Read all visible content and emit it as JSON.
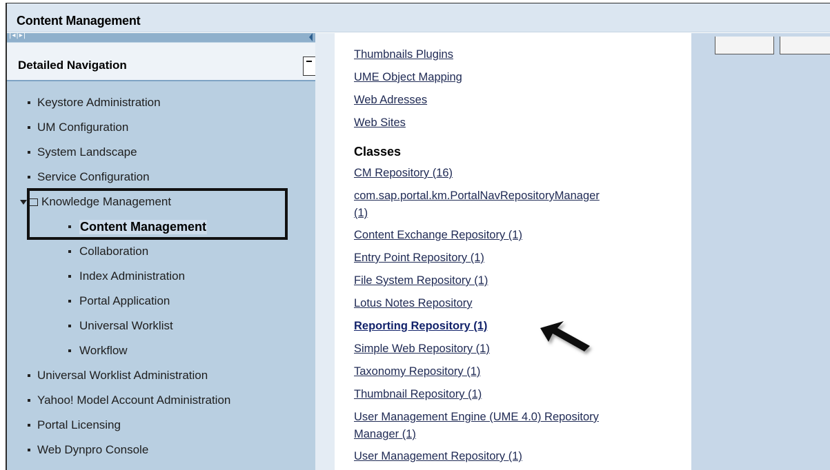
{
  "window": {
    "title": "Content Management"
  },
  "sidebar": {
    "header": "Detailed Navigation",
    "items": [
      {
        "label": "Keystore Administration",
        "level": 1
      },
      {
        "label": "UM Configuration",
        "level": 1
      },
      {
        "label": "System Landscape",
        "level": 1
      },
      {
        "label": "Service Configuration",
        "level": 1
      },
      {
        "label": "Knowledge Management",
        "level": 1,
        "folder": true,
        "expanded": true
      },
      {
        "label": "Content Management",
        "level": 2,
        "selected": true
      },
      {
        "label": "Collaboration",
        "level": 2
      },
      {
        "label": "Index Administration",
        "level": 2
      },
      {
        "label": "Portal Application",
        "level": 2
      },
      {
        "label": "Universal Worklist",
        "level": 2
      },
      {
        "label": "Workflow",
        "level": 2
      },
      {
        "label": "Universal Worklist Administration",
        "level": 1
      },
      {
        "label": "Yahoo! Model Account Administration",
        "level": 1
      },
      {
        "label": "Portal Licensing",
        "level": 1
      },
      {
        "label": "Web Dynpro Console",
        "level": 1
      }
    ]
  },
  "main": {
    "top_links": [
      "Thumbnails Plugins",
      "UME Object Mapping",
      "Web Adresses",
      "Web Sites"
    ],
    "classes_heading": "Classes",
    "class_links": [
      "CM Repository (16)",
      "com.sap.portal.km.PortalNavRepositoryManager",
      "(1)",
      "Content Exchange Repository (1)",
      "Entry Point Repository (1)",
      "File System Repository (1)",
      "Lotus Notes Repository",
      "Reporting Repository (1)",
      "Simple Web Repository (1)",
      "Taxonomy Repository (1)",
      "Thumbnail Repository (1)",
      "User Management Engine (UME 4.0) Repository",
      "Manager (1)",
      "User Management Repository (1)"
    ],
    "highlighted_link": "Reporting Repository (1)"
  },
  "colors": {
    "title_bar": "#dbe6f1",
    "sidebar_bg": "#b9cfe1",
    "link": "#202b55",
    "right_panel": "#c7d7e8"
  },
  "icons": [
    "collapse-arrows-icon",
    "menu-icon",
    "folder-icon",
    "expand-arrow-icon",
    "pointer-arrow-icon"
  ]
}
